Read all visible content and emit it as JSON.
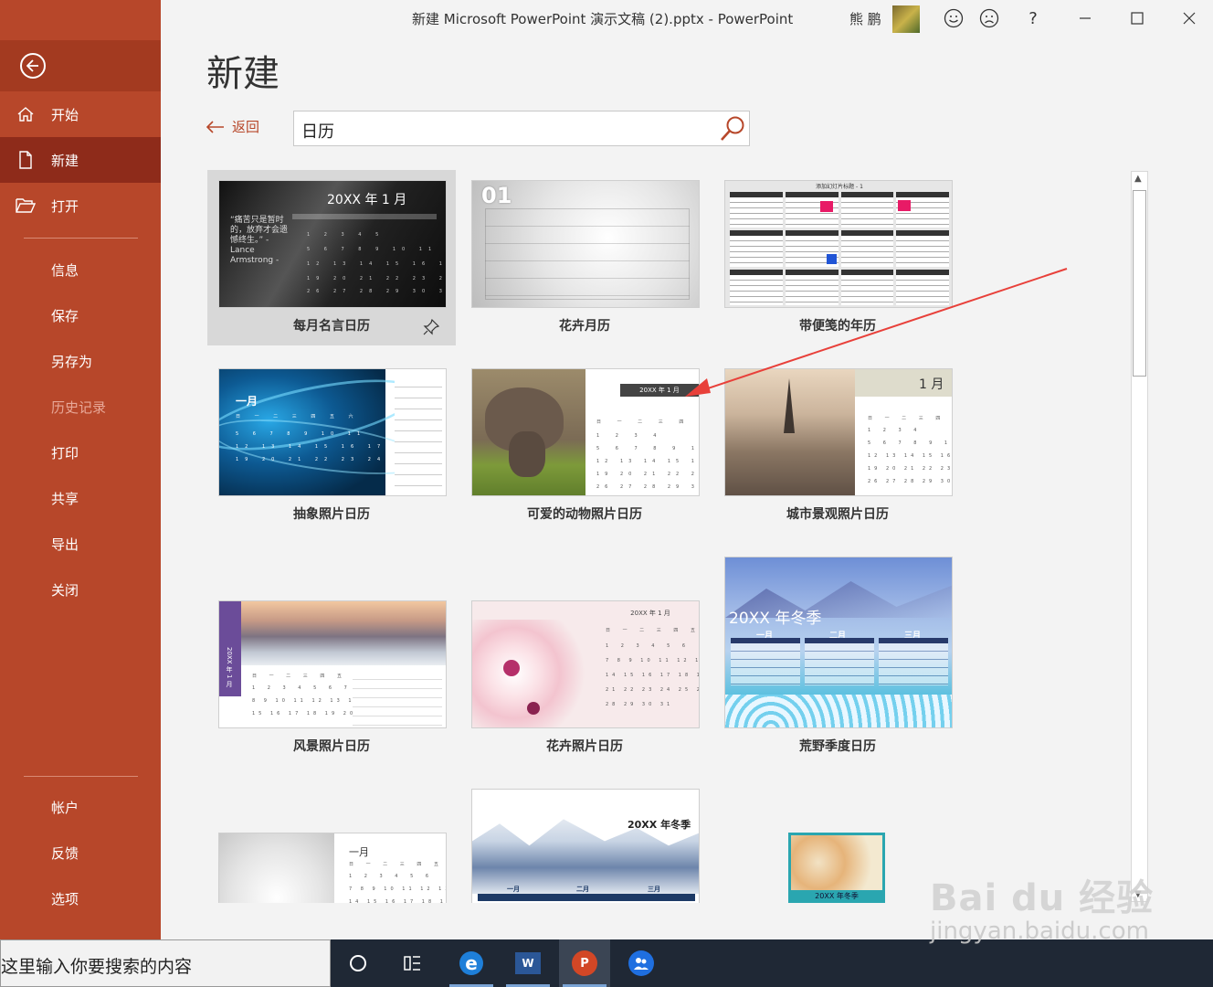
{
  "window": {
    "title": "新建 Microsoft PowerPoint 演示文稿 (2).pptx  -  PowerPoint",
    "user_name": "熊 鹏",
    "controls": [
      "smile-icon",
      "frown-icon",
      "help-icon",
      "minimize-icon",
      "maximize-icon",
      "close-icon"
    ],
    "help_label": "?"
  },
  "sidebar": {
    "back_icon": "back-arrow-icon",
    "top_items": [
      {
        "label": "开始",
        "icon": "home-icon"
      },
      {
        "label": "新建",
        "icon": "new-file-icon",
        "selected": true
      },
      {
        "label": "打开",
        "icon": "folder-open-icon"
      }
    ],
    "items": [
      {
        "label": "信息"
      },
      {
        "label": "保存"
      },
      {
        "label": "另存为"
      },
      {
        "label": "历史记录",
        "disabled": true
      },
      {
        "label": "打印"
      },
      {
        "label": "共享"
      },
      {
        "label": "导出"
      },
      {
        "label": "关闭"
      }
    ],
    "bottom_items": [
      {
        "label": "帐户"
      },
      {
        "label": "反馈"
      },
      {
        "label": "选项"
      }
    ]
  },
  "main": {
    "heading": "新建",
    "back_label": "返回",
    "search": {
      "value": "日历"
    }
  },
  "templates": [
    {
      "name": "每月名言日历",
      "selected": true,
      "thumb_text": "20XX 年 1 月",
      "quote": "“痛苦只是暂时的，放弃才会遗憾终生。” - Lance Armstrong -"
    },
    {
      "name": "花卉月历",
      "thumb_text": "01"
    },
    {
      "name": "带便笺的年历",
      "thumb_text": "添加幻灯片标题 - 1"
    },
    {
      "name": "抽象照片日历",
      "thumb_text": "一月"
    },
    {
      "name": "可爱的动物照片日历",
      "thumb_text": "20XX 年 1 月"
    },
    {
      "name": "城市景观照片日历",
      "thumb_text": "1 月"
    },
    {
      "name": "风景照片日历",
      "thumb_text": "20XX 年 1 月"
    },
    {
      "name": "花卉照片日历",
      "thumb_text": "20XX 年 1 月"
    },
    {
      "name": "荒野季度日历",
      "thumb_text": "20XX 年冬季",
      "months": [
        "一月",
        "二月",
        "三月"
      ]
    },
    {
      "name": "",
      "thumb_text": "一月"
    },
    {
      "name": "",
      "thumb_text": "20XX 年冬季",
      "months": [
        "一月",
        "二月",
        "三月"
      ]
    },
    {
      "name": "",
      "thumb_text": "20XX 年冬季"
    }
  ],
  "taskbar": {
    "search_text": "这里输入你要搜索的内容",
    "apps": [
      "cortana-icon",
      "task-view-icon",
      "edge-icon",
      "word-icon",
      "powerpoint-icon",
      "people-icon"
    ]
  },
  "watermark": {
    "logo": "Bai du 经验",
    "url": "jingyan.baidu.com"
  },
  "colors": {
    "accent": "#b7472a",
    "selected_nav": "#8e2b1a",
    "annotation_arrow": "#e8403a"
  }
}
